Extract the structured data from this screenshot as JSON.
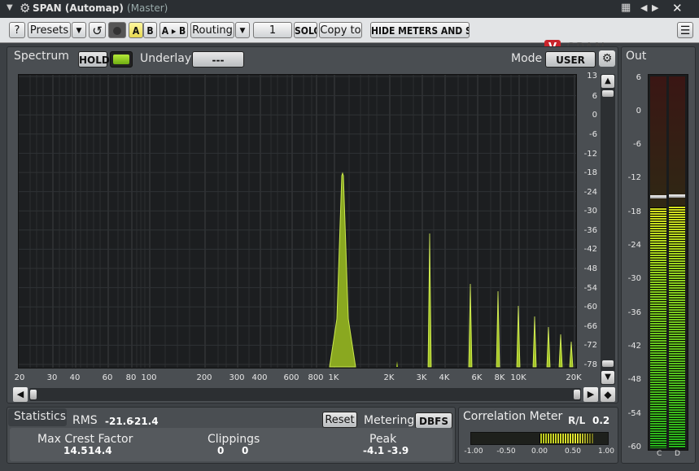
{
  "window": {
    "title": "SPAN (Automap)",
    "subtitle": "(Master)"
  },
  "toolbar": {
    "help": "?",
    "presets": "Presets",
    "a": "A",
    "b": "B",
    "ab": "A ▸ B",
    "routing": "Routing",
    "channel": "1",
    "solo": "SOLO",
    "copy_to": "Copy to",
    "hide_meters": "HIDE METERS AND STATS",
    "brand": "SPAN"
  },
  "spectrum": {
    "label": "Spectrum",
    "hold": "HOLD",
    "underlay_label": "Underlay",
    "underlay_value": "---",
    "mode_label": "Mode",
    "mode_value": "USER",
    "db_ticks": [
      "13",
      "6",
      "0",
      "-6",
      "-12",
      "-18",
      "-24",
      "-30",
      "-36",
      "-42",
      "-48",
      "-54",
      "-60",
      "-66",
      "-72",
      "-78"
    ],
    "freq_ticks": [
      "20",
      "30",
      "40",
      "60",
      "80",
      "100",
      "200",
      "300",
      "400",
      "600",
      "800",
      "1K",
      "2K",
      "3K",
      "4K",
      "6K",
      "8K",
      "10K",
      "20K"
    ]
  },
  "out": {
    "label": "Out",
    "ticks": [
      "6",
      "0",
      "-6",
      "-12",
      "-18",
      "-24",
      "-30",
      "-36",
      "-42",
      "-48",
      "-54",
      "-60"
    ],
    "channels": [
      "C",
      "D"
    ]
  },
  "statistics": {
    "label": "Statistics",
    "rms_label": "RMS",
    "rms_l": "-21.6",
    "rms_r": "-21.4",
    "reset": "Reset",
    "metering_label": "Metering",
    "metering_value": "DBFS",
    "crest_label": "Max Crest Factor",
    "crest_l": "14.5",
    "crest_r": "14.4",
    "clip_label": "Clippings",
    "clip_l": "0",
    "clip_r": "0",
    "peak_label": "Peak",
    "peak_l": "-4.1",
    "peak_r": "-3.9"
  },
  "correlation": {
    "label": "Correlation Meter",
    "mode": "R/L",
    "value": "0.2",
    "ticks": [
      "-1.00",
      "-0.50",
      "0.00",
      "0.50",
      "1.00"
    ]
  }
}
